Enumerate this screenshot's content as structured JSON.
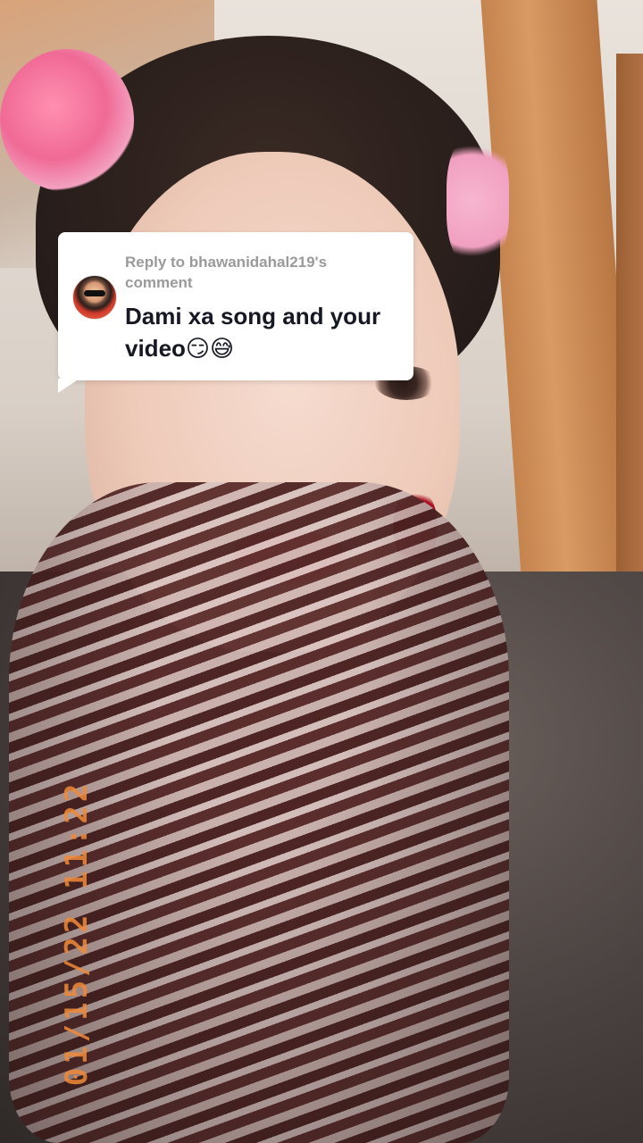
{
  "reply_card": {
    "meta": "Reply to bhawanidahal219's comment",
    "comment_text": "Dami xa song and your video😏😅",
    "avatar_icon": "user-avatar"
  },
  "video": {
    "date_stamp": "01/15/22 11:22",
    "date_stamp_color": "#f08a3a"
  },
  "colors": {
    "card_background": "#ffffff",
    "meta_text": "#9a9a9a",
    "comment_text": "#161823"
  }
}
